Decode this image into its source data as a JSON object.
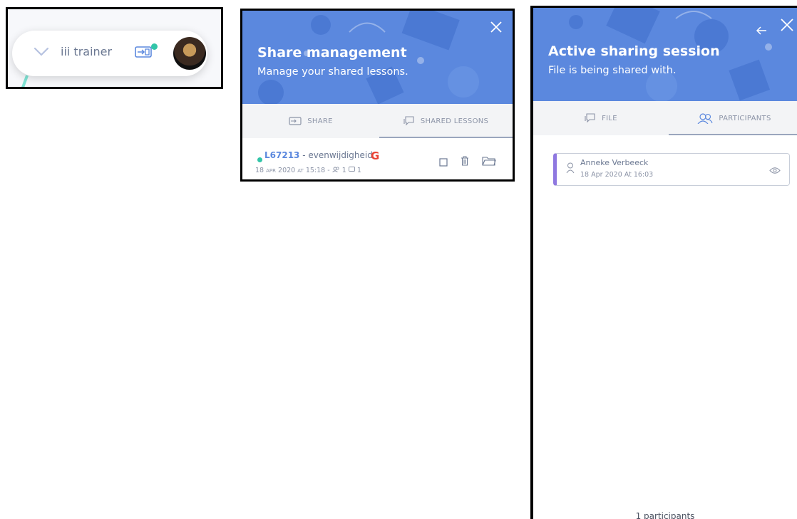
{
  "topbar": {
    "username": "iii trainer",
    "icons": {
      "collapse": "chevron-down-icon",
      "share": "share-screen-icon",
      "avatar": "user-avatar"
    },
    "status_color": "#32c5a8"
  },
  "share_management": {
    "title": "Share management",
    "subtitle": "Manage your shared lessons.",
    "tabs": [
      {
        "label": "SHARE",
        "icon": "share-screen-icon"
      },
      {
        "label": "SHARED LESSONS",
        "icon": "shared-lessons-icon",
        "active": true
      }
    ],
    "lessons": [
      {
        "code": "L67213",
        "separator": " - ",
        "name": "evenwijdigheid",
        "source": "google-icon",
        "date_day": "18",
        "date_month": "APR",
        "date_year": "2020",
        "at": "AT",
        "time": "15:18",
        "participants": "1",
        "messages": "1"
      }
    ]
  },
  "active_session": {
    "title": "Active sharing session",
    "subtitle": "File is being shared with.",
    "tabs": [
      {
        "label": "FILE",
        "icon": "file-icon"
      },
      {
        "label": "PARTICIPANTS",
        "icon": "participants-icon",
        "active": true
      }
    ],
    "participants": [
      {
        "name": "Anneke Verbeeck",
        "joined": "18 Apr 2020 At 16:03"
      }
    ],
    "footer": "1 participants"
  },
  "colors": {
    "header_bg": "#5b88de",
    "accent_teal": "#32c5a8",
    "participant_bar": "#8f78e0"
  }
}
